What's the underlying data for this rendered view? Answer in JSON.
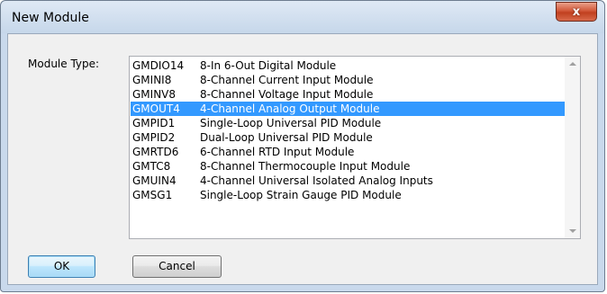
{
  "window": {
    "title": "New Module",
    "close_glyph": "x"
  },
  "form": {
    "module_type_label": "Module Type:"
  },
  "module_list": {
    "selected_index": 3,
    "items": [
      {
        "code": "GMDIO14",
        "description": "8-In 6-Out Digital Module"
      },
      {
        "code": "GMINI8",
        "description": "8-Channel Current Input Module"
      },
      {
        "code": "GMINV8",
        "description": "8-Channel Voltage Input Module"
      },
      {
        "code": "GMOUT4",
        "description": "4-Channel Analog Output Module"
      },
      {
        "code": "GMPID1",
        "description": "Single-Loop Universal PID Module"
      },
      {
        "code": "GMPID2",
        "description": "Dual-Loop Universal PID Module"
      },
      {
        "code": "GMRTD6",
        "description": "6-Channel RTD Input Module"
      },
      {
        "code": "GMTC8",
        "description": "8-Channel Thermocouple Input Module"
      },
      {
        "code": "GMUIN4",
        "description": "4-Channel Universal Isolated Analog Inputs"
      },
      {
        "code": "GMSG1",
        "description": "Single-Loop Strain Gauge PID Module"
      }
    ]
  },
  "buttons": {
    "ok_label": "OK",
    "cancel_label": "Cancel"
  }
}
